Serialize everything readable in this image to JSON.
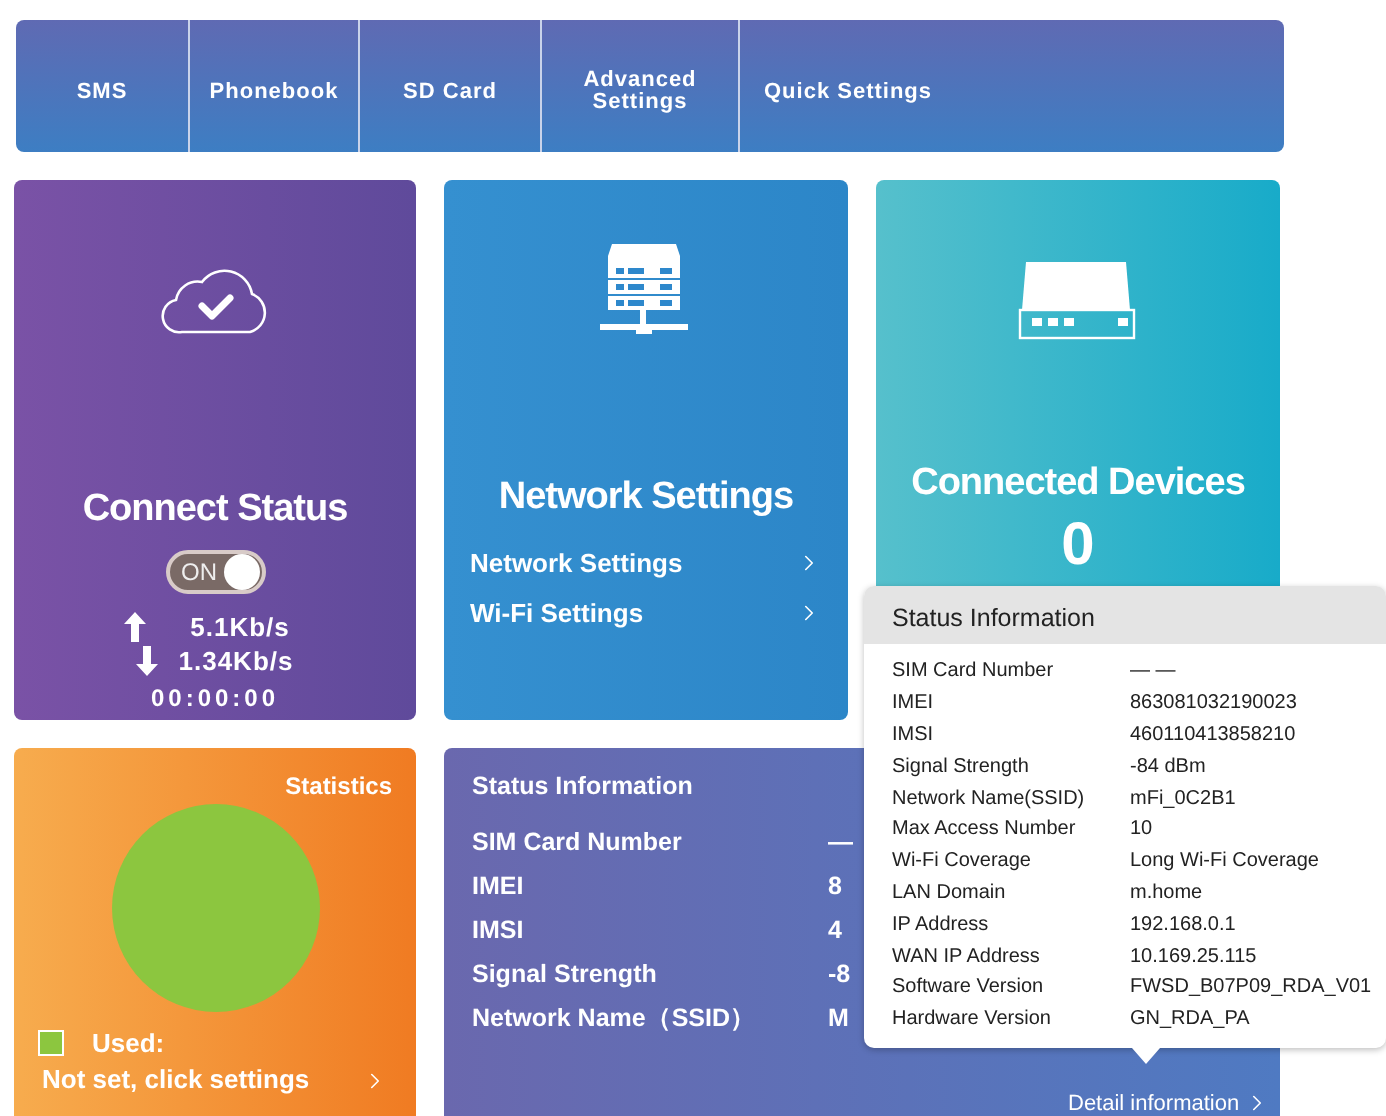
{
  "nav": {
    "tabs": [
      {
        "label": "SMS"
      },
      {
        "label": "Phonebook"
      },
      {
        "label": "SD Card"
      },
      {
        "label": "Advanced Settings"
      },
      {
        "label": "Quick Settings"
      }
    ]
  },
  "connect_status": {
    "title": "Connect Status",
    "switch_on": true,
    "switch_label": "ON",
    "upload": "5.1Kb/s",
    "download": "1.34Kb/s",
    "duration": "00:00:00"
  },
  "network_settings": {
    "title": "Network Settings",
    "links": [
      "Network Settings",
      "Wi-Fi Settings"
    ]
  },
  "connected_devices": {
    "title": "Connected Devices",
    "count": "0"
  },
  "statistics": {
    "title": "Statistics",
    "legend": {
      "label": "Used:",
      "color": "#8cc63f"
    },
    "action": "Not set, click settings"
  },
  "status_information": {
    "title": "Status Information",
    "rows": [
      {
        "label": "SIM Card Number",
        "value": "—"
      },
      {
        "label": "IMEI",
        "value": "8"
      },
      {
        "label": "IMSI",
        "value": "4"
      },
      {
        "label": "Signal Strength",
        "value": "-8"
      },
      {
        "label": "Network Name（SSID）",
        "value": "M"
      }
    ],
    "detail_link": "Detail information"
  },
  "popup": {
    "title": "Status Information",
    "rows": [
      {
        "label": "SIM Card Number",
        "value": "— —"
      },
      {
        "label": "IMEI",
        "value": "863081032190023"
      },
      {
        "label": "IMSI",
        "value": "460110413858210"
      },
      {
        "label": "Signal Strength",
        "value": "-84 dBm"
      },
      {
        "label": "Network Name(SSID)",
        "value": "mFi_0C2B1"
      },
      {
        "label": "Max Access Number",
        "value": "10"
      },
      {
        "label": "Wi-Fi Coverage",
        "value": "Long Wi-Fi Coverage"
      },
      {
        "label": "LAN Domain",
        "value": "m.home"
      },
      {
        "label": "IP Address",
        "value": "192.168.0.1"
      },
      {
        "label": "WAN IP Address",
        "value": "10.169.25.115"
      },
      {
        "label": "Software Version",
        "value": "FWSD_B07P09_RDA_V01"
      },
      {
        "label": "Hardware Version",
        "value": "GN_RDA_PA"
      }
    ]
  }
}
